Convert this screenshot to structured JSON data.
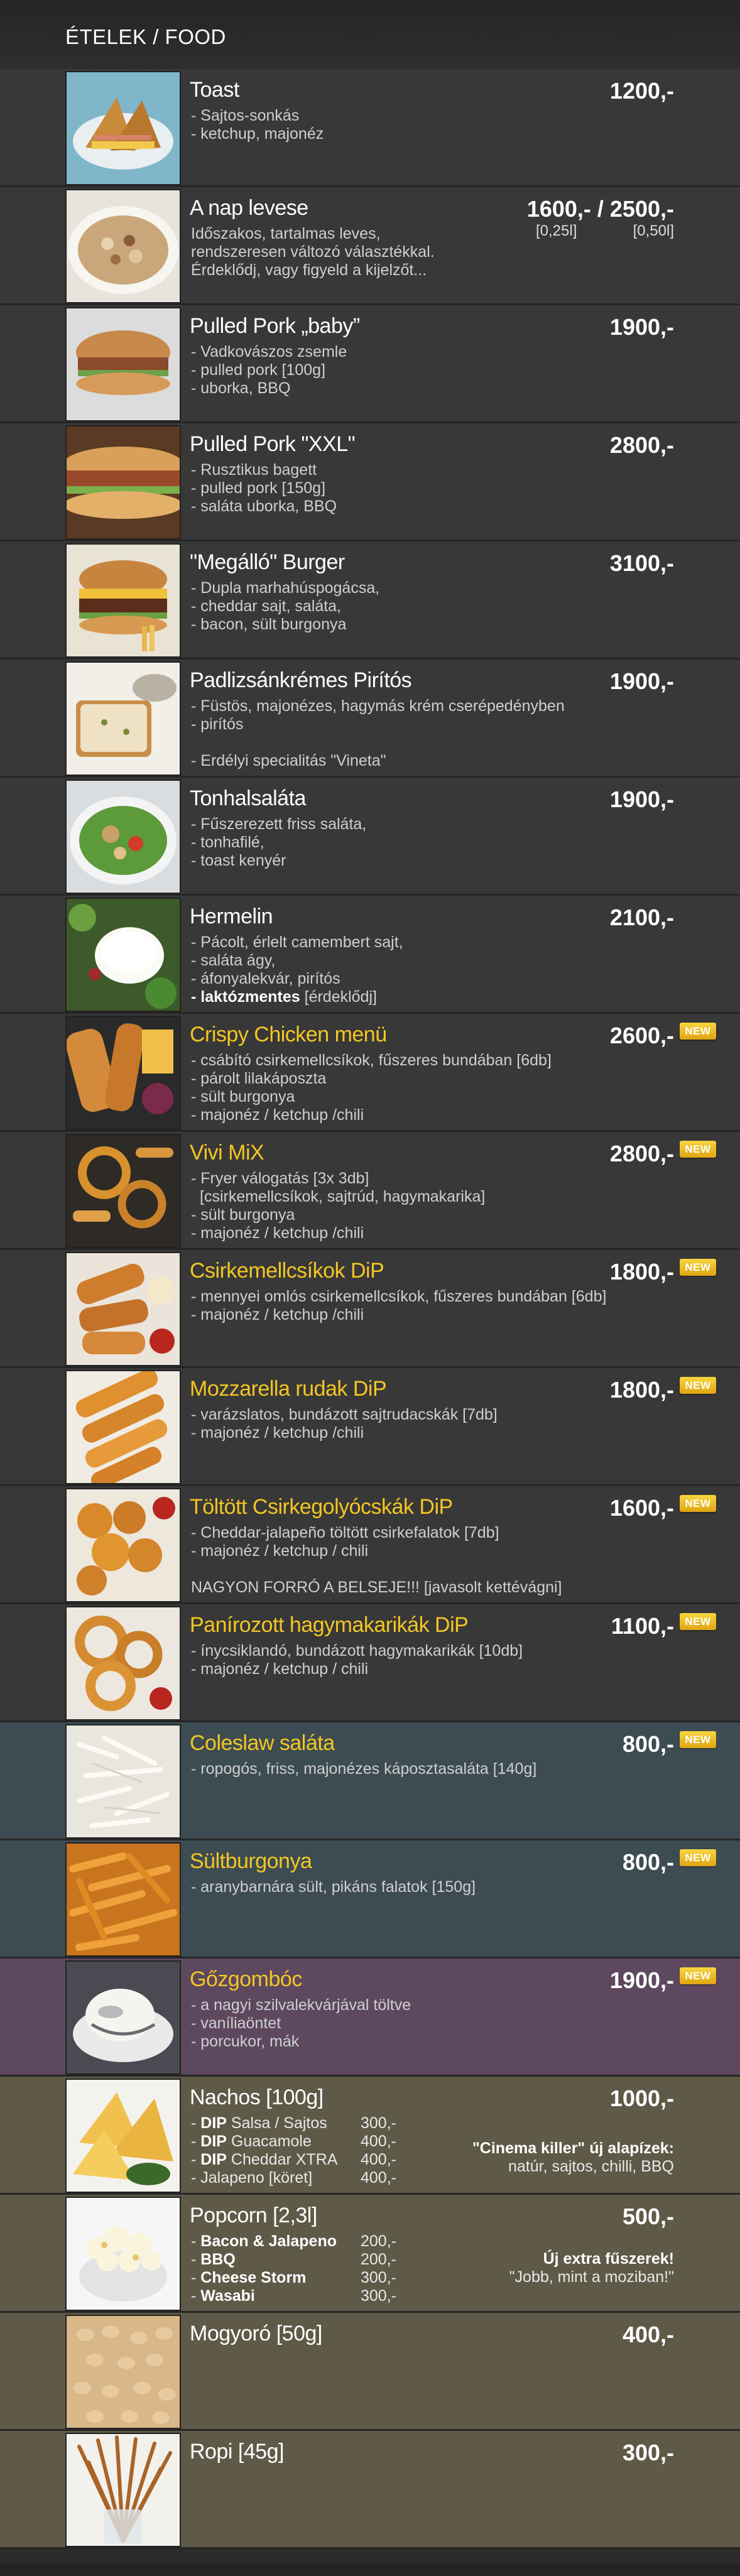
{
  "header": {
    "title": "ÉTELEK / FOOD"
  },
  "badge_label": "NEW",
  "items": [
    {
      "name": "Toast",
      "price": "1200,-",
      "desc": [
        "- Sajtos-sonkás",
        "- ketchup, majonéz"
      ],
      "icon": "toast-image"
    },
    {
      "name": "A nap levese",
      "price_a": "1600,- / 2500,-",
      "size_a": "[0,25l]",
      "size_b": "[0,50l]",
      "desc": [
        "Időszakos, tartalmas leves,",
        "rendszeresen változó választékkal.",
        "Érdeklődj, vagy figyeld a kijelzőt..."
      ],
      "icon": "soup-image"
    },
    {
      "name": "Pulled Pork „baby”",
      "price": "1900,-",
      "desc": [
        "- Vadkovászos zsemle",
        "- pulled pork [100g]",
        "- uborka, BBQ"
      ],
      "icon": "burger-image"
    },
    {
      "name": "Pulled Pork \"XXL\"",
      "price": "2800,-",
      "desc": [
        "- Rusztikus bagett",
        "- pulled pork [150g]",
        "- saláta uborka, BBQ"
      ],
      "icon": "baguette-image"
    },
    {
      "name": "\"Megálló\" Burger",
      "price": "3100,-",
      "desc": [
        "- Dupla marhahúspogácsa,",
        "- cheddar sajt, saláta,",
        "- bacon, sült burgonya"
      ],
      "icon": "burger-fries-image"
    },
    {
      "name": "Padlizsánkrémes Pirítós",
      "price": "1900,-",
      "desc": [
        "- Füstös, majonézes, hagymás krém cserépedényben",
        "- pirítós",
        "",
        "- Erdélyi specialitás \"Vineta\""
      ],
      "icon": "toast-spread-image"
    },
    {
      "name": "Tonhalsaláta",
      "price": "1900,-",
      "desc": [
        "- Fűszerezett friss saláta,",
        "- tonhafilé,",
        "- toast kenyér"
      ],
      "icon": "salad-image"
    },
    {
      "name": "Hermelin",
      "price": "2100,-",
      "desc": [
        "- Pácolt, érlelt camembert sajt,",
        "- saláta ágy,",
        "- áfonyalekvár, pirítós",
        "- laktózmentes",
        "[érdeklődj]"
      ],
      "icon": "cheese-plate-image"
    },
    {
      "name": "Crispy Chicken menü",
      "price": "2600,-",
      "new": true,
      "desc": [
        "- csábító csirkemellcsíkok, fűszeres bundában [6db]",
        "- párolt lilakáposzta",
        "- sült burgonya",
        "- majonéz / ketchup /chili"
      ],
      "icon": "chicken-menu-image"
    },
    {
      "name": "Vivi MiX",
      "price": "2800,-",
      "new": true,
      "desc": [
        "- Fryer válogatás [3x 3db]",
        "  [csirkemellcsíkok, sajtrúd, hagymakarika]",
        "- sült burgonya",
        "- majonéz / ketchup /chili"
      ],
      "icon": "mix-image"
    },
    {
      "name": "Csirkemellcsíkok DiP",
      "price": "1800,-",
      "new": true,
      "desc": [
        "- mennyei omlós csirkemellcsíkok, fűszeres bundában [6db]",
        "- majonéz / ketchup /chili"
      ],
      "icon": "chicken-strips-image"
    },
    {
      "name": "Mozzarella rudak DiP",
      "price": "1800,-",
      "new": true,
      "desc": [
        "- varázslatos, bundázott sajtrudacskák [7db]",
        "- majonéz / ketchup /chili"
      ],
      "icon": "mozzarella-sticks-image"
    },
    {
      "name": "Töltött Csirkegolyócskák DiP",
      "price": "1600,-",
      "new": true,
      "desc": [
        "- Cheddar-jalapeño töltött csirkefalatok [7db]",
        "- majonéz / ketchup / chili",
        "",
        "NAGYON FORRÓ A BELSEJE!!! [javasolt kettévágni]"
      ],
      "icon": "chicken-balls-image"
    },
    {
      "name": "Panírozott hagymakarikák DiP",
      "price": "1100,-",
      "new": true,
      "desc": [
        "- ínycsiklandó, bundázott hagymakarikák [10db]",
        "- majonéz / ketchup / chili"
      ],
      "icon": "onion-rings-image"
    },
    {
      "name": "Coleslaw saláta",
      "price": "800,-",
      "new": true,
      "desc": [
        "- ropogós, friss, majonézes káposztasaláta [140g]"
      ],
      "icon": "coleslaw-image"
    },
    {
      "name": "Sültburgonya",
      "price": "800,-",
      "new": true,
      "desc": [
        "- aranybarnára sült, pikáns falatok [150g]"
      ],
      "icon": "fries-image"
    },
    {
      "name": "Gőzgombóc",
      "price": "1900,-",
      "new": true,
      "desc": [
        "- a nagyi szilvalekvárjával töltve",
        "- vaníliaöntet",
        "- porcukor, mák"
      ],
      "icon": "dumpling-image"
    },
    {
      "name": "Nachos [100g]",
      "price": "1000,-",
      "addons": [
        {
          "label": "DIP",
          "rest": " Salsa / Sajtos",
          "value": "300,-"
        },
        {
          "label": "DIP",
          "rest": " Guacamole",
          "value": "400,-"
        },
        {
          "label": "DIP",
          "rest": " Cheddar XTRA",
          "value": "400,-"
        },
        {
          "label": "",
          "rest": "Jalapeno [köret]",
          "value": "400,-"
        }
      ],
      "extra_title": "\"Cinema killer\" új alapízek:",
      "extra_text": "natúr, sajtos, chilli, BBQ",
      "icon": "nachos-image"
    },
    {
      "name": "Popcorn [2,3l]",
      "price": "500,-",
      "addons": [
        {
          "label": "",
          "rest": "Bacon & Jalapeno",
          "value": "200,-"
        },
        {
          "label": "",
          "rest": "BBQ",
          "value": "200,-"
        },
        {
          "label": "",
          "rest": "Cheese Storm",
          "value": "300,-"
        },
        {
          "label": "",
          "rest": "Wasabi",
          "value": "300,-"
        }
      ],
      "extra_title": "Új extra fűszerek!",
      "extra_text": "\"Jobb, mint a moziban!\"",
      "icon": "popcorn-image"
    },
    {
      "name": "Mogyoró [50g]",
      "price": "400,-",
      "desc": [],
      "icon": "peanuts-image"
    },
    {
      "name": "Ropi [45g]",
      "price": "300,-",
      "desc": [],
      "icon": "pretzel-sticks-image"
    }
  ]
}
